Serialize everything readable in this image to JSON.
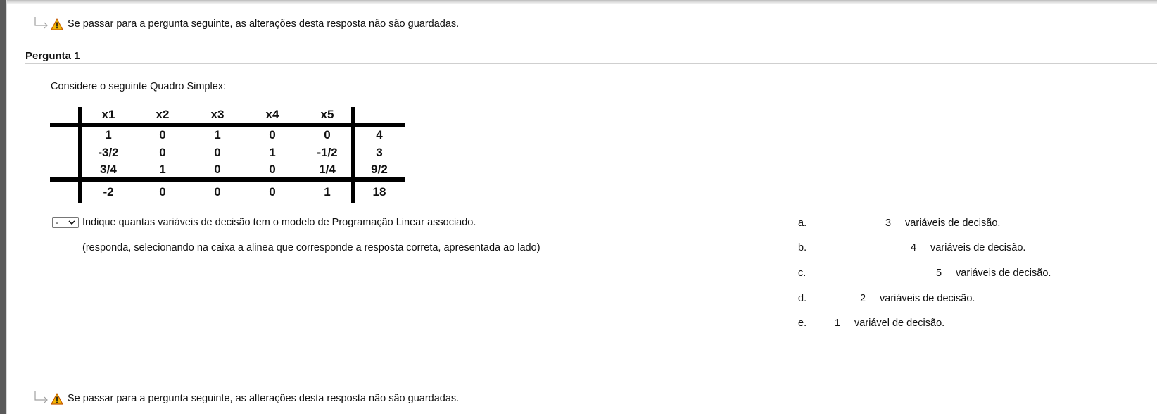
{
  "warning": {
    "text": "Se passar para a pergunta seguinte, as alterações desta resposta não são guardadas."
  },
  "question": {
    "title": "Pergunta 1",
    "prompt": "Considere o seguinte Quadro Simplex:",
    "text": "Indique quantas variáveis de decisão tem o modelo de Programação Linear associado.",
    "note": "(responda, selecionando na caixa a alinea que corresponde a resposta correta, apresentada ao lado)",
    "select_value": "-"
  },
  "simplex": {
    "headers": [
      "x1",
      "x2",
      "x3",
      "x4",
      "x5"
    ],
    "rows": [
      [
        "1",
        "0",
        "1",
        "0",
        "0",
        "4"
      ],
      [
        "-3/2",
        "0",
        "0",
        "1",
        "-1/2",
        "3"
      ],
      [
        "3/4",
        "1",
        "0",
        "0",
        "1/4",
        "9/2"
      ],
      [
        "-2",
        "0",
        "0",
        "0",
        "1",
        "18"
      ]
    ]
  },
  "options": [
    {
      "letter": "a.",
      "number": "3",
      "label": "variáveis de decisão."
    },
    {
      "letter": "b.",
      "number": "4",
      "label": "variáveis de decisão."
    },
    {
      "letter": "c.",
      "number": "5",
      "label": "variáveis de decisão."
    },
    {
      "letter": "d.",
      "number": "2",
      "label": "variáveis de decisão."
    },
    {
      "letter": "e.",
      "number": "1",
      "label": "variável de decisão."
    }
  ],
  "colors": {
    "warning_fill": "#f2b705",
    "warning_stroke": "#c45a00",
    "arrow": "#9a9a9a"
  }
}
